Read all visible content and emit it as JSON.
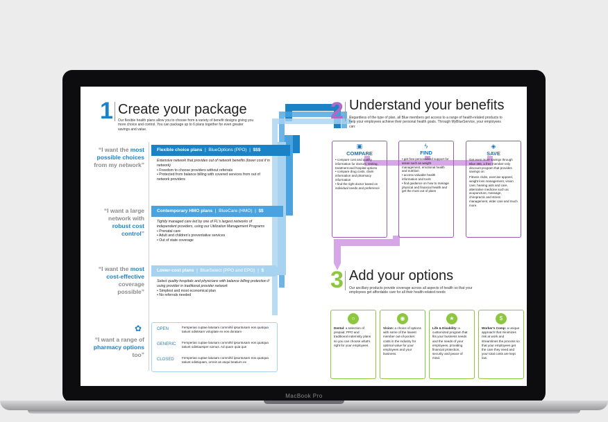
{
  "device": {
    "label": "MacBook Pro"
  },
  "s1": {
    "num": "1",
    "title": "Create your package",
    "intro": "Our flexible health plans allow you to choose from a variety of benefit designs giving you more choice and control. You can package up to 6 plans together for even greater savings and value."
  },
  "q1": {
    "a": "“I want the ",
    "b": "most possible choices",
    "c": " from my network”"
  },
  "q2": {
    "a": "“I want a large network with ",
    "b": "robust cost control",
    "c": "”"
  },
  "q3": {
    "a": "“I want the ",
    "b": "most cost-effective",
    "c": " coverage possible”"
  },
  "q4": {
    "a": "“I want a range of ",
    "b": "pharmacy options",
    "c": " too”"
  },
  "plans": [
    {
      "title": "Flexible choice plans",
      "sub": "BlueOptions (PPO)",
      "price": "$$$",
      "desc": "Extensive network that provides out of network benefits (lower cost if in network)",
      "b1": "• Freedom to choose providers without referrals",
      "b2": "• Protected from balance billing with covered services from out of network providers",
      "b3": ""
    },
    {
      "title": "Contemporary HMO plans",
      "sub": "BlueCare (HMO)",
      "price": "$$",
      "desc": "Tightly managed care led by one of FL's largest networks of independent providers, using our Utilization Management Programs",
      "b1": "• Prenatal care",
      "b2": "• Adult and children's preventative services",
      "b3": "• Out of state coverage"
    },
    {
      "title": "Lower-cost plans",
      "sub": "BlueSelect (PPO and EPO)",
      "price": "$",
      "desc": "Select quality hospitals and physicians with balance billing protection if using provider in traditional provider network",
      "b1": "• Simplest and most economical plan",
      "b2": "• No referrals needed",
      "b3": ""
    }
  ],
  "pharmacy": [
    {
      "type": "OPEN",
      "text": "Fersperias cuptae latusam commihil ipsuntusam eos quatqua tatiunt odistisam voluptate ex eos doratam"
    },
    {
      "type": "GENERIC",
      "text": "Fersperias cuptae latusam commihil ipsuntusam eos quatqua tatiunt odistiaesper namus. Ad quam quia que"
    },
    {
      "type": "CLOSED",
      "text": "Fersperias cuptae latusam commihil ipsuntusam eos quatqua tatiunt odistiquam, omnis as asqui beatium ex"
    }
  ],
  "s2": {
    "num": "2",
    "title": "Understand your benefits",
    "intro": "Regardless of the type of plan, all Blue members get access to a range of health-related products to help your employees achieve their personal health goals. Through MyBlueService, your employees can:"
  },
  "benefits": [
    {
      "title": "COMPARE",
      "icon": "compare-icon",
      "lines": [
        "• compare cost and quality information for doctors, testing, treatment and hospital options",
        "• compare drug costs, claim information and pharmacy information",
        "• find the right doctor based on individual needs and preference"
      ]
    },
    {
      "title": "FIND",
      "icon": "find-icon",
      "lines": [
        "• get free personalized support for areas such as weight management, emotional health and nutrition",
        "• access valuable health information and tools",
        "• find guidance on how to manage physical and financial health and get the most out of plans"
      ]
    },
    {
      "title": "SAVE",
      "icon": "save-icon",
      "lines": [
        "Get even more savings through Blue 365, a free member-only discount program that provides savings on:",
        "Fitness clubs, exercise apparel, weight loss management, vision care, hearing aids and care, alternative medicine such as acupuncture, massage, chiropractic and stress management, elder care and much more."
      ]
    }
  ],
  "s3": {
    "num": "3",
    "title": "Add your options",
    "intro": "Our ancillary products provide coverage across all aspects of health so that your employees get affordable care for all their health-related needs"
  },
  "options": [
    {
      "icon": "tooth-icon",
      "glyph": "○",
      "head": "Dental:",
      "text": " a selection of prepaid, PPO and traditional indemnity plans so you can choose what's right for your employees."
    },
    {
      "icon": "eye-icon",
      "glyph": "◉",
      "head": "Vision:",
      "text": " a choice of options with some of the lowest member out-of-pocket costs in the industry for optimal value for your employees and your business."
    },
    {
      "icon": "person-icon",
      "glyph": "★",
      "head": "Life & Disability:",
      "text": " a customized program that fits your business needs and the needs of your employees, providing financial protection, security and peace of mind."
    },
    {
      "icon": "money-icon",
      "glyph": "$",
      "head": "Worker's Comp:",
      "text": " a unique approach that minimizes risk at work and streamlines the process so that your employees get the care they need and your total costs are kept low."
    }
  ],
  "colors": {
    "blue": "#1b82c5",
    "mid": "#4aa3df",
    "light": "#a8d3f0",
    "purple": "#b06ac5",
    "green": "#8dc63f"
  }
}
